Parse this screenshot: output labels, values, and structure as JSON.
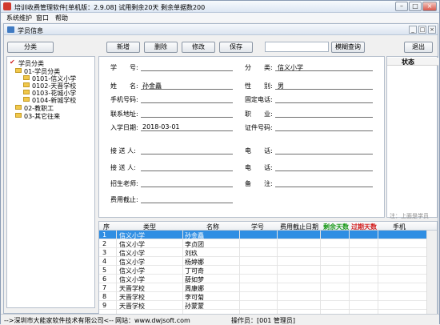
{
  "window": {
    "title": "培训收费管理软件[单机版：2.9.08] 试用剩余20天 剩余单据数200",
    "controls": [
      "0",
      "1",
      "r"
    ]
  },
  "menu": [
    "系统维护",
    "窗口",
    "帮助"
  ],
  "child": {
    "title": "学员信息",
    "controls": [
      "_",
      "□",
      "×"
    ]
  },
  "toolbar": {
    "classify": "分类",
    "add": "新增",
    "delete": "删除",
    "modify": "修改",
    "save": "保存",
    "search_placeholder": "",
    "fuzzy_search": "模糊查询",
    "exit": "退出"
  },
  "tree": {
    "root": "学员分类",
    "nodes": [
      {
        "label": "01-学员分类",
        "indent": 1
      },
      {
        "label": "0101-信义小学",
        "indent": 2
      },
      {
        "label": "0102-天晋学校",
        "indent": 2
      },
      {
        "label": "0103-花城小学",
        "indent": 2
      },
      {
        "label": "0104-新城学校",
        "indent": 2
      },
      {
        "label": "02-教职工",
        "indent": 1
      },
      {
        "label": "03-其它往来",
        "indent": 1
      }
    ]
  },
  "form": {
    "student_no_label": "学　　号:",
    "category_label": "分　　类:",
    "category_value": "信义小学",
    "name_label": "姓　　名:",
    "name_value": "孙金矗",
    "gender_label": "性　　别:",
    "gender_value": "男",
    "mobile_label": "手机号码:",
    "landline_label": "固定电话:",
    "address_label": "联系地址:",
    "job_label": "职　　业:",
    "enroll_label": "入学日期:",
    "enroll_value": "2018-03-01",
    "id_label": "证件号码:",
    "pickup1_label": "接 送 人:",
    "phone1_label": "电　　话:",
    "pickup2_label": "接 送 人:",
    "phone2_label": "电　　话:",
    "recruiter_label": "招生老师:",
    "remark_label": "备　　注:",
    "fee_deadline_label": "费用截止:"
  },
  "status": {
    "title": "状态",
    "note": "注：上面是学员"
  },
  "grid": {
    "headers": [
      "序",
      "类型",
      "名称",
      "学号",
      "费用截止日期",
      "剩余天数",
      "过期天数",
      "手机"
    ],
    "header_colors": {
      "remain": "#1a9a1a",
      "expired": "#d21c1c"
    },
    "rows": [
      {
        "no": "1",
        "type": "信义小学",
        "name": "孙金矗"
      },
      {
        "no": "2",
        "type": "信义小学",
        "name": "李贞团"
      },
      {
        "no": "3",
        "type": "信义小学",
        "name": "刘玖"
      },
      {
        "no": "4",
        "type": "信义小学",
        "name": "杨婷娜"
      },
      {
        "no": "5",
        "type": "信义小学",
        "name": "丁可奇"
      },
      {
        "no": "6",
        "type": "信义小学",
        "name": "薛如梦"
      },
      {
        "no": "7",
        "type": "天晋学校",
        "name": "周康娜"
      },
      {
        "no": "8",
        "type": "天晋学校",
        "name": "李可菊"
      },
      {
        "no": "9",
        "type": "天晋学校",
        "name": "孙蒙蒙"
      }
    ]
  },
  "footer": {
    "company": "-->深圳市大能家软件技术有限公司<--",
    "website": "网站：www.dwjsoft.com",
    "operator": "操作员：[001 管理员]"
  }
}
